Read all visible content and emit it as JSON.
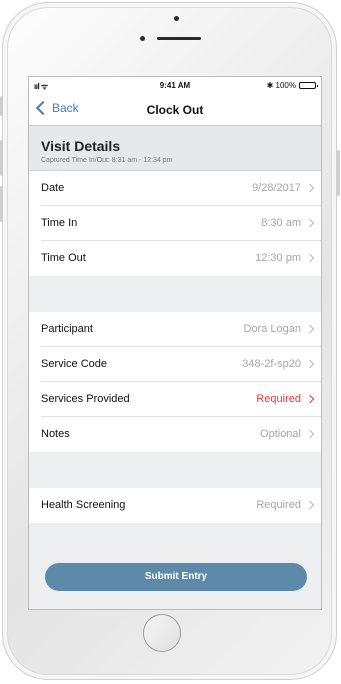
{
  "status_bar": {
    "signal": "ııl ᯤ",
    "time": "9:41 AM",
    "battery_text": "✱ 100%"
  },
  "navbar": {
    "back_label": "Back",
    "title": "Clock Out"
  },
  "visit_details": {
    "title": "Visit Details",
    "subtitle": "Captured Time In/Out: 8:31 am - 12:34 pm"
  },
  "rows": {
    "date": {
      "label": "Date",
      "value": "9/28/2017"
    },
    "time_in": {
      "label": "Time In",
      "value": "8:30 am"
    },
    "time_out": {
      "label": "Time Out",
      "value": "12:30 pm"
    },
    "participant": {
      "label": "Participant",
      "value": "Dora Logan"
    },
    "service_code": {
      "label": "Service Code",
      "value": "348-2f-sp20"
    },
    "services_provided": {
      "label": "Services Provided",
      "value": "Required"
    },
    "notes": {
      "label": "Notes",
      "value": "Optional"
    },
    "health_screening": {
      "label": "Health Screening",
      "value": "Required"
    }
  },
  "submit_label": "Submit Entry",
  "colors": {
    "accent": "#3f7fbf",
    "required": "#e53935",
    "submit": "#5d8aa8",
    "section_bg": "#e6e9ec"
  },
  "icons": [
    "back-chevron-icon",
    "chevron-right-icon",
    "signal-icon",
    "wifi-icon",
    "bluetooth-icon",
    "battery-icon"
  ]
}
